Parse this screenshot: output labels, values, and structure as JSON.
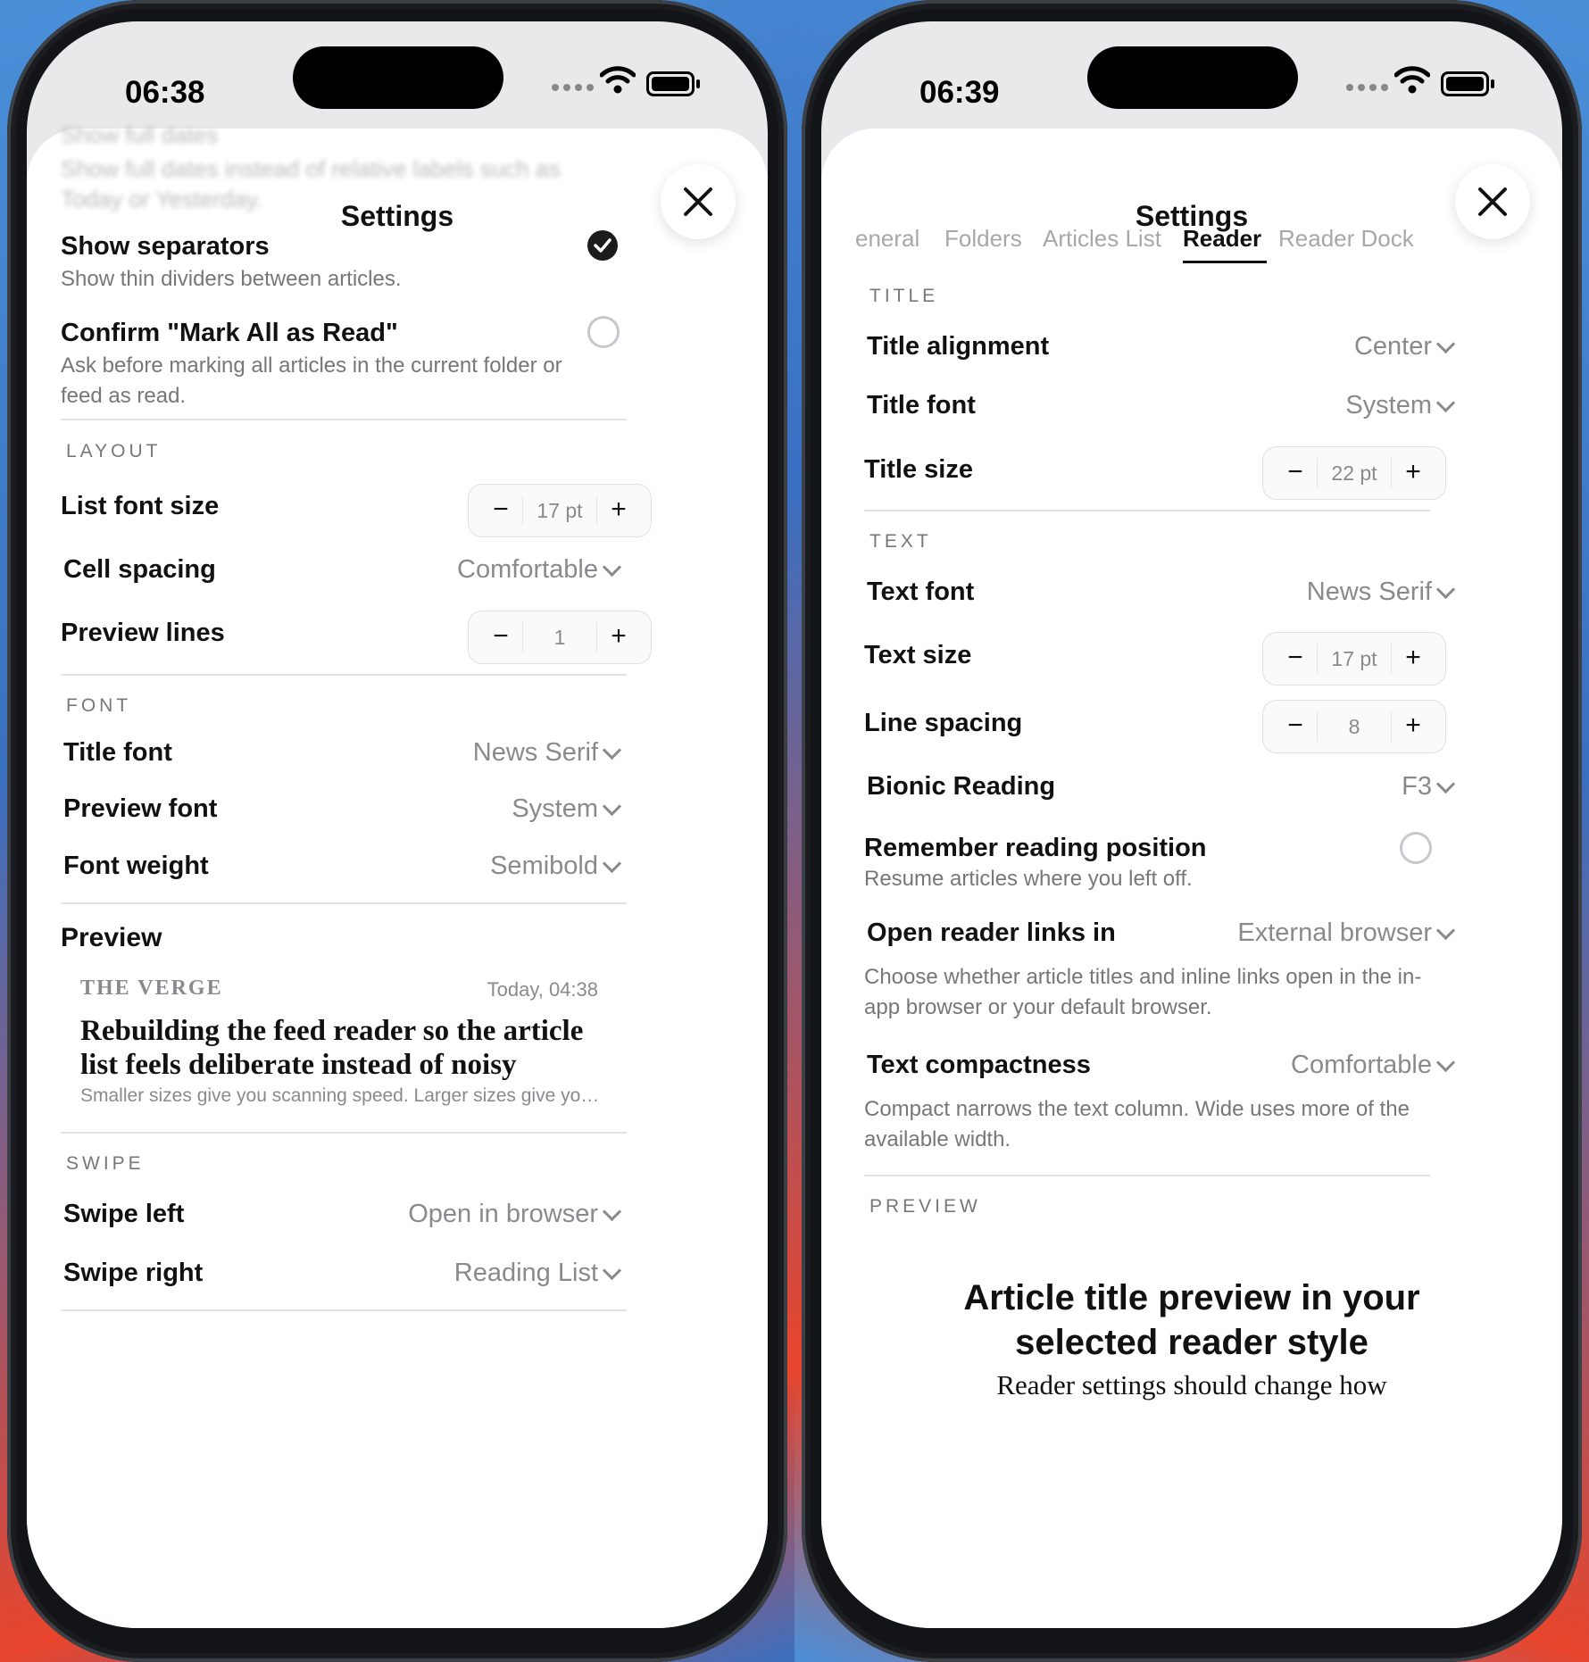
{
  "left": {
    "status": {
      "time": "06:38"
    },
    "title": "Settings",
    "ghost": {
      "label": "Show full dates",
      "desc": "Show full dates instead of relative labels such as Today or Yesterday."
    },
    "toggles": [
      {
        "label": "Show separators",
        "desc": "Show thin dividers between articles.",
        "checked": true
      },
      {
        "label": "Confirm \"Mark All as Read\"",
        "desc": "Ask before marking all articles in the current folder or feed as read.",
        "checked": false
      }
    ],
    "layout": {
      "header": "LAYOUT",
      "list_font_size": {
        "label": "List font size",
        "value": "17 pt"
      },
      "cell_spacing": {
        "label": "Cell spacing",
        "value": "Comfortable"
      },
      "preview_lines": {
        "label": "Preview lines",
        "value": "1"
      }
    },
    "font": {
      "header": "FONT",
      "title_font": {
        "label": "Title font",
        "value": "News Serif"
      },
      "preview_font": {
        "label": "Preview font",
        "value": "System"
      },
      "font_weight": {
        "label": "Font weight",
        "value": "Semibold"
      }
    },
    "preview": {
      "header": "Preview",
      "source": "THE VERGE",
      "time": "Today, 04:38",
      "title": "Rebuilding the feed reader so the article list feels deliberate instead of noisy",
      "text": "Smaller sizes give you scanning speed. Larger sizes give you presence and a calmer rhythm."
    },
    "swipe": {
      "header": "SWIPE",
      "left": {
        "label": "Swipe left",
        "value": "Open in browser"
      },
      "right": {
        "label": "Swipe right",
        "value": "Reading List"
      }
    },
    "stepper_minus": "−",
    "stepper_plus": "+"
  },
  "right": {
    "status": {
      "time": "06:39"
    },
    "title": "Settings",
    "tabs": [
      "eneral",
      "Folders",
      "Articles List",
      "Reader",
      "Reader Dock"
    ],
    "active_tab": "Reader",
    "title_section": {
      "header": "TITLE",
      "alignment": {
        "label": "Title alignment",
        "value": "Center"
      },
      "font": {
        "label": "Title font",
        "value": "System"
      },
      "size": {
        "label": "Title size",
        "value": "22 pt"
      }
    },
    "text_section": {
      "header": "TEXT",
      "font": {
        "label": "Text font",
        "value": "News Serif"
      },
      "size": {
        "label": "Text size",
        "value": "17 pt"
      },
      "line_spacing": {
        "label": "Line spacing",
        "value": "8"
      },
      "bionic": {
        "label": "Bionic Reading",
        "value": "F3"
      },
      "remember": {
        "label": "Remember reading position",
        "desc": "Resume articles where you left off.",
        "checked": false
      },
      "links": {
        "label": "Open reader links in",
        "value": "External browser",
        "desc": "Choose whether article titles and inline links open in the in-app browser or your default browser."
      },
      "compactness": {
        "label": "Text compactness",
        "value": "Comfortable",
        "desc": "Compact narrows the text column. Wide uses more of the available width."
      }
    },
    "preview": {
      "header": "PREVIEW",
      "title": "Article title preview in your selected reader style",
      "body": "Reader settings should change how"
    },
    "stepper_minus": "−",
    "stepper_plus": "+"
  }
}
